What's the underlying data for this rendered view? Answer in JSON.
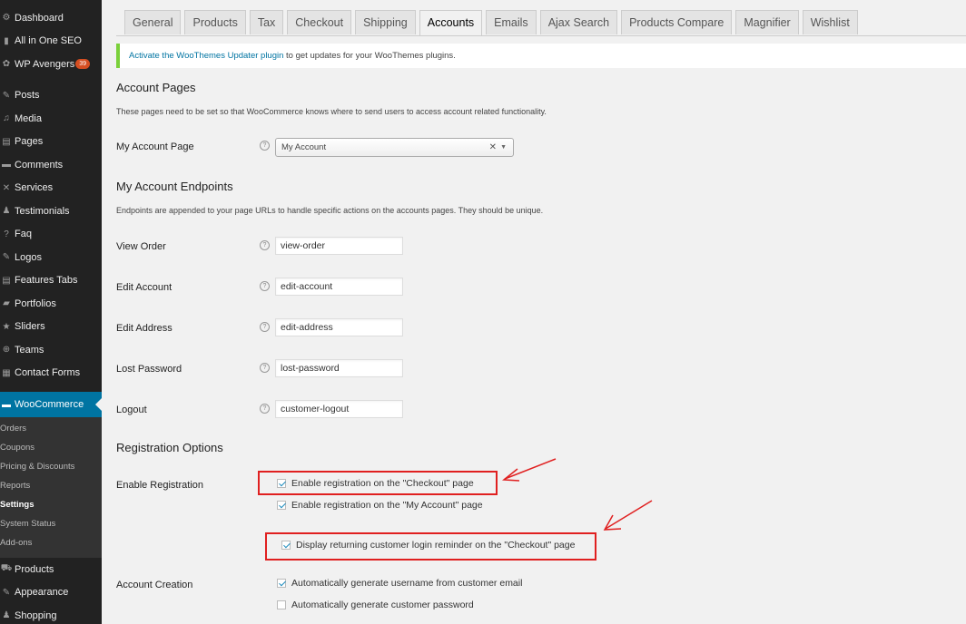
{
  "sidebar": {
    "items_top": [
      {
        "label": "Dashboard",
        "icon": "dashboard-icon",
        "glyph": "⚙"
      },
      {
        "label": "All in One SEO",
        "icon": "seo-icon",
        "glyph": "▮"
      },
      {
        "label": "WP Avengers",
        "icon": "wp-avengers-icon",
        "glyph": "✿",
        "badge": "39"
      }
    ],
    "items_mid": [
      {
        "label": "Posts",
        "icon": "pin-icon",
        "glyph": "✎"
      },
      {
        "label": "Media",
        "icon": "media-icon",
        "glyph": "♫"
      },
      {
        "label": "Pages",
        "icon": "pages-icon",
        "glyph": "▤"
      },
      {
        "label": "Comments",
        "icon": "comments-icon",
        "glyph": "▬"
      },
      {
        "label": "Services",
        "icon": "services-icon",
        "glyph": "✕"
      },
      {
        "label": "Testimonials",
        "icon": "testimonials-icon",
        "glyph": "♟"
      },
      {
        "label": "Faq",
        "icon": "faq-icon",
        "glyph": "?"
      },
      {
        "label": "Logos",
        "icon": "pin-icon",
        "glyph": "✎"
      },
      {
        "label": "Features Tabs",
        "icon": "features-tabs-icon",
        "glyph": "▤"
      },
      {
        "label": "Portfolios",
        "icon": "portfolio-icon",
        "glyph": "▰"
      },
      {
        "label": "Sliders",
        "icon": "star-icon",
        "glyph": "★"
      },
      {
        "label": "Teams",
        "icon": "teams-icon",
        "glyph": "⊕"
      },
      {
        "label": "Contact Forms",
        "icon": "contact-forms-icon",
        "glyph": "▦"
      }
    ],
    "woocommerce": {
      "label": "WooCommerce",
      "icon": "woocommerce-icon",
      "glyph": "▬"
    },
    "submenu": [
      {
        "label": "Orders"
      },
      {
        "label": "Coupons"
      },
      {
        "label": "Pricing & Discounts"
      },
      {
        "label": "Reports"
      },
      {
        "label": "Settings",
        "current": true
      },
      {
        "label": "System Status"
      },
      {
        "label": "Add-ons"
      }
    ],
    "items_bottom": [
      {
        "label": "Products",
        "icon": "cart-icon",
        "glyph": "⛟"
      },
      {
        "label": "Appearance",
        "icon": "appearance-icon",
        "glyph": "✎"
      },
      {
        "label": "Shopping",
        "icon": "shopping-icon",
        "glyph": "♟"
      }
    ]
  },
  "tabs": [
    {
      "label": "General"
    },
    {
      "label": "Products"
    },
    {
      "label": "Tax"
    },
    {
      "label": "Checkout"
    },
    {
      "label": "Shipping"
    },
    {
      "label": "Accounts",
      "active": true
    },
    {
      "label": "Emails"
    },
    {
      "label": "Ajax Search"
    },
    {
      "label": "Products Compare"
    },
    {
      "label": "Magnifier"
    },
    {
      "label": "Wishlist"
    }
  ],
  "notice": {
    "link": "Activate the WooThemes Updater plugin",
    "text": " to get updates for your WooThemes plugins."
  },
  "account_pages": {
    "heading": "Account Pages",
    "description": "These pages need to be set so that WooCommerce knows where to send users to access account related functionality.",
    "my_account_label": "My Account Page",
    "my_account_value": "My Account",
    "clear_glyph": "✕",
    "arrow_glyph": "▼"
  },
  "endpoints": {
    "heading": "My Account Endpoints",
    "description": "Endpoints are appended to your page URLs to handle specific actions on the accounts pages. They should be unique.",
    "rows": [
      {
        "label": "View Order",
        "value": "view-order"
      },
      {
        "label": "Edit Account",
        "value": "edit-account"
      },
      {
        "label": "Edit Address",
        "value": "edit-address"
      },
      {
        "label": "Lost Password",
        "value": "lost-password"
      },
      {
        "label": "Logout",
        "value": "customer-logout"
      }
    ]
  },
  "registration": {
    "heading": "Registration Options",
    "enable_label": "Enable Registration",
    "checkout_reg": {
      "label": "Enable registration on the \"Checkout\" page",
      "checked": true
    },
    "myaccount_reg": {
      "label": "Enable registration on the \"My Account\" page",
      "checked": true
    },
    "login_reminder": {
      "label": "Display returning customer login reminder on the \"Checkout\" page",
      "checked": true
    },
    "account_creation_label": "Account Creation",
    "auto_username": {
      "label": "Automatically generate username from customer email",
      "checked": true
    },
    "auto_password": {
      "label": "Automatically generate customer password",
      "checked": false
    }
  },
  "help_glyph": "?",
  "colors": {
    "annotation": "#e02020",
    "accent": "#0074a2",
    "notice_border": "#7ad03a"
  }
}
